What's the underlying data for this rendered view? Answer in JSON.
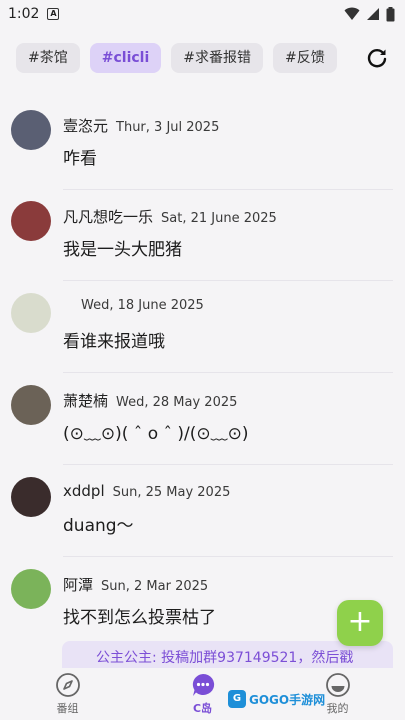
{
  "status_bar": {
    "time": "1:02",
    "app_badge": "A"
  },
  "tags": [
    {
      "label": "#茶馆",
      "active": false
    },
    {
      "label": "#clicli",
      "active": true
    },
    {
      "label": "#求番报错",
      "active": false
    },
    {
      "label": "#反馈",
      "active": false
    }
  ],
  "posts": [
    {
      "name": "壹恣元",
      "date": "Thur, 3 Jul 2025",
      "body": "咋看",
      "avatar_color": "#5a5f73"
    },
    {
      "name": "凡凡想吃一乐",
      "date": "Sat, 21 June 2025",
      "body": "我是一头大肥猪",
      "avatar_color": "#8a3b3b"
    },
    {
      "name": "",
      "date": "Wed, 18 June 2025",
      "body": "看谁来报道哦",
      "avatar_color": "#d9dccd"
    },
    {
      "name": "萧楚楠",
      "date": "Wed, 28 May 2025",
      "body": "(⊙﹏⊙)( ˆ o ˆ )/(⊙﹏⊙)",
      "avatar_color": "#6b6257"
    },
    {
      "name": "xddpl",
      "date": "Sun, 25 May 2025",
      "body": "duang～",
      "avatar_color": "#3a2c2c"
    },
    {
      "name": "阿潭",
      "date": "Sun, 2 Mar 2025",
      "body": "找不到怎么投票枯了",
      "avatar_color": "#7bb35a"
    }
  ],
  "notice": {
    "text": "公主公主: 投稿加群937149521，然后戳"
  },
  "fab": {
    "label": "+"
  },
  "nav": [
    {
      "label": "番组",
      "icon": "compass-icon",
      "active": false
    },
    {
      "label": "C岛",
      "icon": "chat-bubble-icon",
      "active": true
    },
    {
      "label": "我的",
      "icon": "smile-icon",
      "active": false
    }
  ],
  "watermark": {
    "logo": "G",
    "text": "GOGO手游网"
  },
  "colors": {
    "accent": "#7a4ed6",
    "fab": "#8fd14b",
    "active_tag_bg": "#ddd2f7"
  }
}
